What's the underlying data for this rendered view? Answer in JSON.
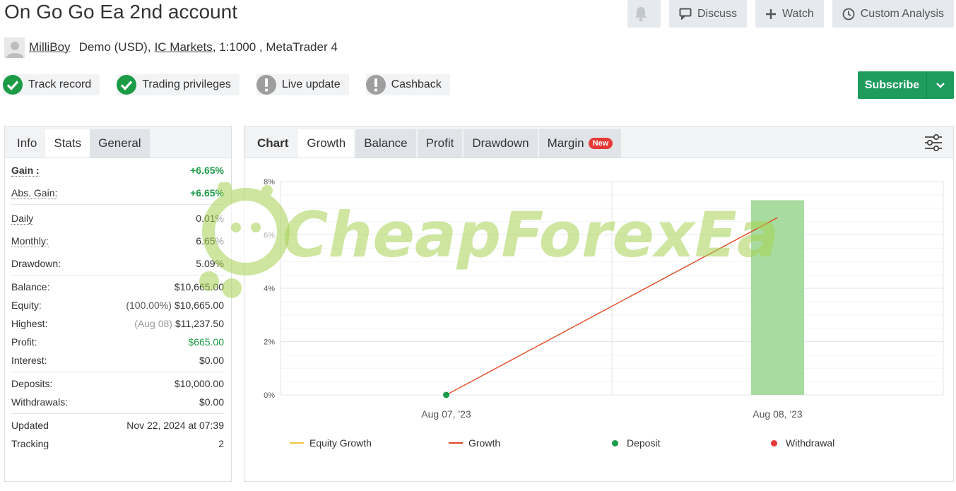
{
  "header": {
    "title": "On Go Go Ea 2nd account",
    "discuss_label": "Discuss",
    "watch_label": "Watch",
    "custom_analysis_label": "Custom Analysis"
  },
  "account": {
    "username": "MilliBoy",
    "type": "Demo (USD),",
    "broker": "IC Markets",
    "leverage_platform": ", 1:1000 , MetaTrader 4"
  },
  "badges": [
    {
      "label": "Track record",
      "status": "verified",
      "color": "#1c9b47"
    },
    {
      "label": "Trading privileges",
      "status": "verified",
      "color": "#1c9b47"
    },
    {
      "label": "Live update",
      "status": "warning",
      "color": "#9e9e9e"
    },
    {
      "label": "Cashback",
      "status": "warning",
      "color": "#9e9e9e"
    }
  ],
  "subscribe": {
    "label": "Subscribe",
    "color": "#1d9c5e"
  },
  "left_tabs": [
    "Info",
    "Stats",
    "General"
  ],
  "stats": {
    "gain": {
      "label": "Gain :",
      "value": "+6.65%"
    },
    "abs_gain": {
      "label": "Abs. Gain:",
      "value": "+6.65%"
    },
    "daily": {
      "label": "Daily",
      "value": "0.01%"
    },
    "monthly": {
      "label": "Monthly:",
      "value": "6.65%"
    },
    "drawdown": {
      "label": "Drawdown:",
      "value": "5.09%"
    },
    "balance": {
      "label": "Balance:",
      "value": "$10,665.00"
    },
    "equity": {
      "label": "Equity:",
      "prefix": "(100.00%)",
      "value": "$10,665.00"
    },
    "highest": {
      "label": "Highest:",
      "prefix": "(Aug 08)",
      "value": "$11,237.50"
    },
    "profit": {
      "label": "Profit:",
      "value": "$665.00"
    },
    "interest": {
      "label": "Interest:",
      "value": "$0.00"
    },
    "deposits": {
      "label": "Deposits:",
      "value": "$10,000.00"
    },
    "withdrawals": {
      "label": "Withdrawals:",
      "value": "$0.00"
    },
    "updated": {
      "label": "Updated",
      "value": "Nov 22, 2024 at 07:39"
    },
    "tracking": {
      "label": "Tracking",
      "value": "2"
    }
  },
  "chart_tabs": {
    "chart": "Chart",
    "growth": "Growth",
    "balance": "Balance",
    "profit": "Profit",
    "drawdown": "Drawdown",
    "margin": "Margin",
    "new_tag": "New"
  },
  "watermark": {
    "text": "CheapForexEa"
  },
  "chart_data": {
    "type": "line",
    "categories": [
      "Aug 07, '23",
      "Aug 08, '23"
    ],
    "ylim": [
      0,
      8
    ],
    "yticks": [
      "0%",
      "2%",
      "4%",
      "6%",
      "8%"
    ],
    "grid": true,
    "series": [
      {
        "name": "Growth",
        "type": "line",
        "color": "#e0491f",
        "values": [
          0,
          6.65
        ]
      },
      {
        "name": "Equity Growth",
        "type": "line",
        "color": "#f5c542",
        "values": []
      },
      {
        "name": "Deposit",
        "type": "marker",
        "color": "#1c9b47",
        "values": [
          0,
          null
        ]
      },
      {
        "name": "Withdrawal",
        "type": "marker",
        "color": "#e53935",
        "values": []
      }
    ],
    "bars": {
      "color": "#a8dba0",
      "values": [
        null,
        7.3
      ]
    },
    "legend": [
      "Equity Growth",
      "Growth",
      "Deposit",
      "Withdrawal"
    ],
    "legend_position": "bottom"
  }
}
